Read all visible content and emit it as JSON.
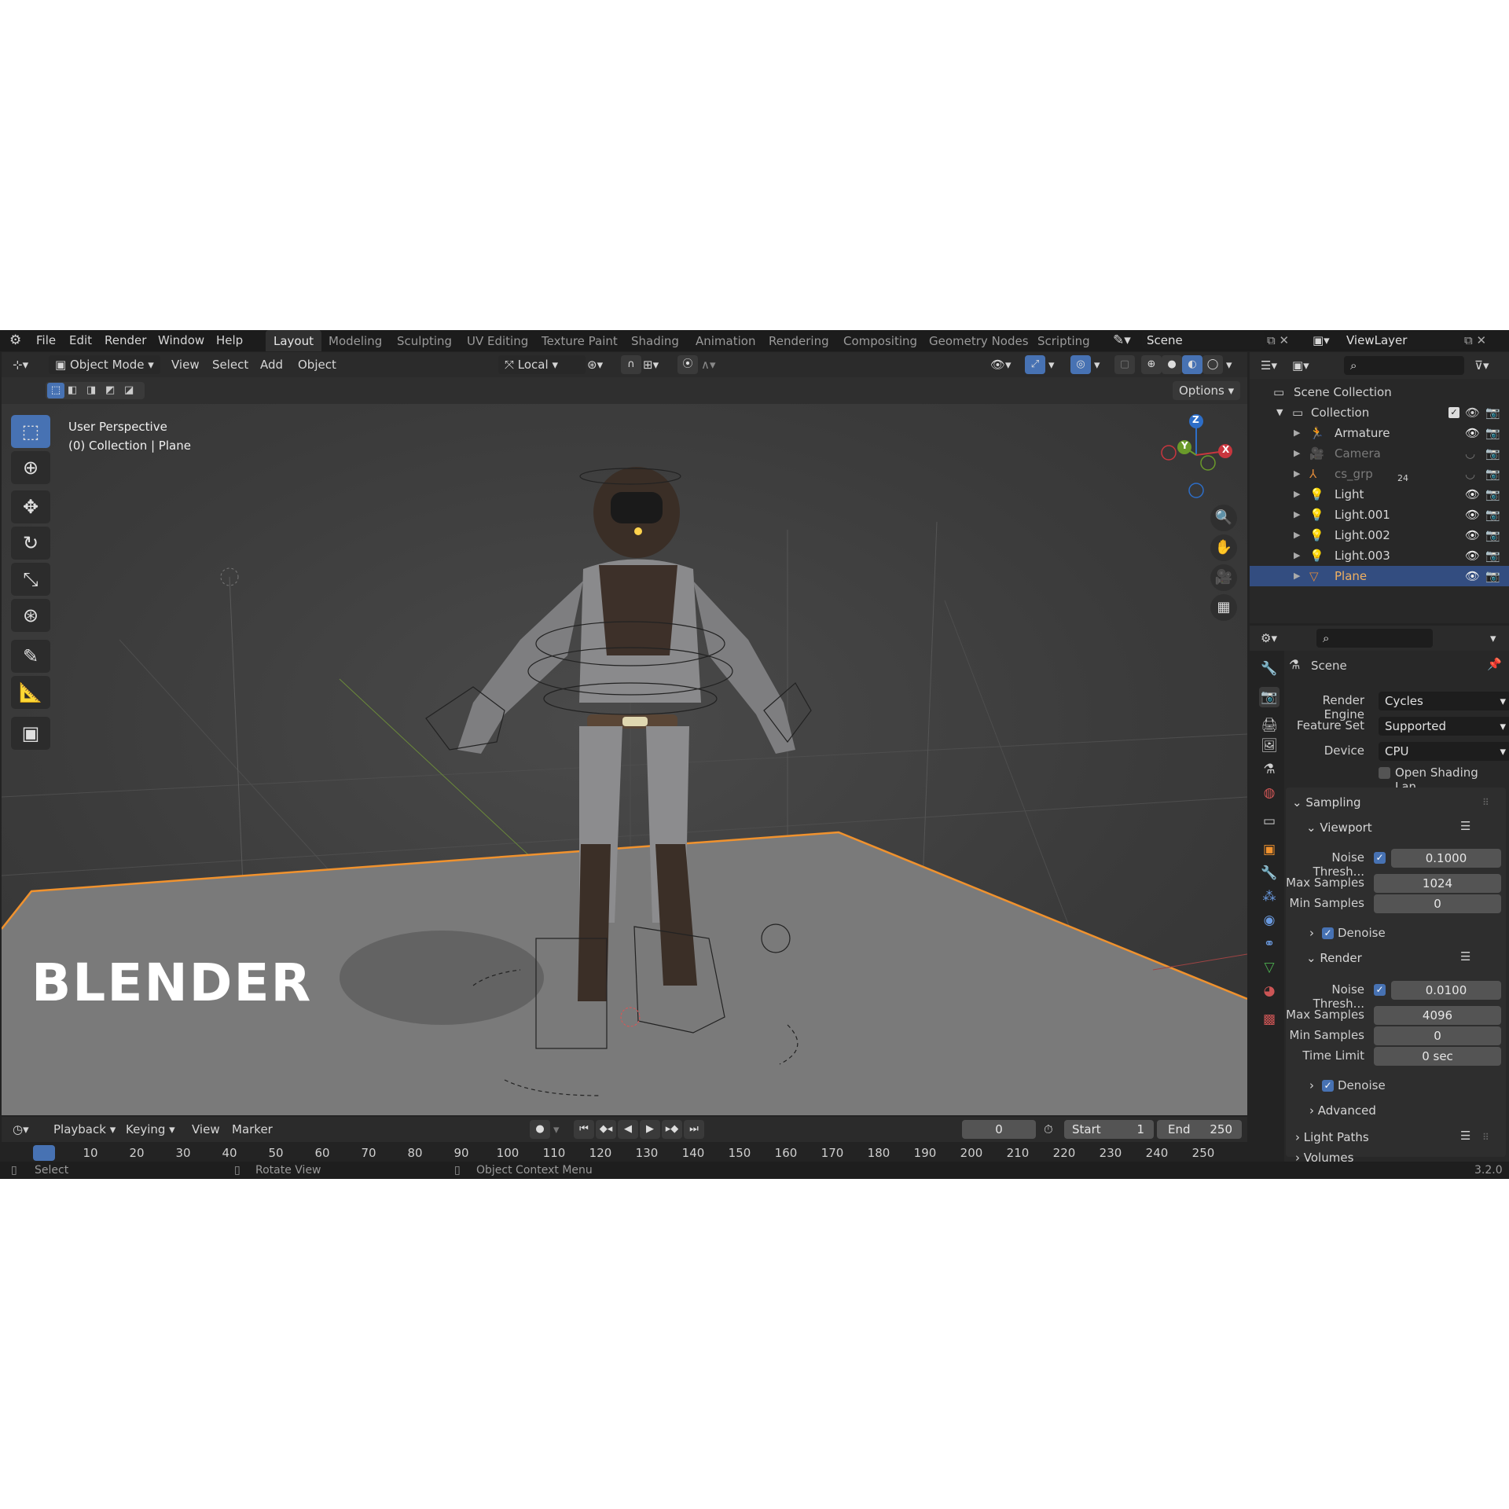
{
  "menu": {
    "file": "File",
    "edit": "Edit",
    "render": "Render",
    "window": "Window",
    "help": "Help"
  },
  "workspaces": [
    "Layout",
    "Modeling",
    "Sculpting",
    "UV Editing",
    "Texture Paint",
    "Shading",
    "Animation",
    "Rendering",
    "Compositing",
    "Geometry Nodes",
    "Scripting"
  ],
  "scene_name": "Scene",
  "view_layer": "ViewLayer",
  "viewport_header": {
    "mode": "Object Mode",
    "view": "View",
    "select": "Select",
    "add": "Add",
    "object": "Object",
    "transform_orientation": "Local",
    "options": "Options"
  },
  "viewport": {
    "perspective": "User Perspective",
    "context": "(0) Collection | Plane",
    "watermark": "BLENDER",
    "gizmo": {
      "z": "Z",
      "y": "Y",
      "x": "X"
    }
  },
  "outliner": {
    "scene_collection": "Scene Collection",
    "collection": "Collection",
    "items": [
      {
        "name": "Armature",
        "hidden": false
      },
      {
        "name": "Camera",
        "hidden": true
      },
      {
        "name": "cs_grp",
        "hidden": true,
        "badge": "24"
      },
      {
        "name": "Light",
        "hidden": false
      },
      {
        "name": "Light.001",
        "hidden": false
      },
      {
        "name": "Light.002",
        "hidden": false
      },
      {
        "name": "Light.003",
        "hidden": false
      },
      {
        "name": "Plane",
        "hidden": false,
        "selected": true
      }
    ]
  },
  "properties": {
    "context": "Scene",
    "render_engine_label": "Render Engine",
    "render_engine": "Cycles",
    "feature_set_label": "Feature Set",
    "feature_set": "Supported",
    "device_label": "Device",
    "device": "CPU",
    "osl_label": "Open Shading Lan...",
    "sampling": "Sampling",
    "viewport": {
      "title": "Viewport",
      "noise_label": "Noise Thresh...",
      "noise": "0.1000",
      "max_label": "Max Samples",
      "max": "1024",
      "min_label": "Min Samples",
      "min": "0",
      "denoise": "Denoise"
    },
    "render": {
      "title": "Render",
      "noise_label": "Noise Thresh...",
      "noise": "0.0100",
      "max_label": "Max Samples",
      "max": "4096",
      "min_label": "Min Samples",
      "min": "0",
      "time_label": "Time Limit",
      "time": "0 sec",
      "denoise": "Denoise",
      "advanced": "Advanced"
    },
    "light_paths": "Light Paths",
    "volumes": "Volumes"
  },
  "timeline": {
    "playback": "Playback",
    "keying": "Keying",
    "view": "View",
    "marker": "Marker",
    "current_frame": "0",
    "start_label": "Start",
    "start": "1",
    "end_label": "End",
    "end": "250",
    "ticks": [
      "0",
      "10",
      "20",
      "30",
      "40",
      "50",
      "60",
      "70",
      "80",
      "90",
      "100",
      "110",
      "120",
      "130",
      "140",
      "150",
      "160",
      "170",
      "180",
      "190",
      "200",
      "210",
      "220",
      "230",
      "240",
      "250"
    ]
  },
  "status": {
    "select": "Select",
    "rotate": "Rotate View",
    "context_menu": "Object Context Menu",
    "version": "3.2.0"
  },
  "colors": {
    "accent": "#4772b3",
    "selection_orange": "#f0922e",
    "bg": "#232323"
  }
}
